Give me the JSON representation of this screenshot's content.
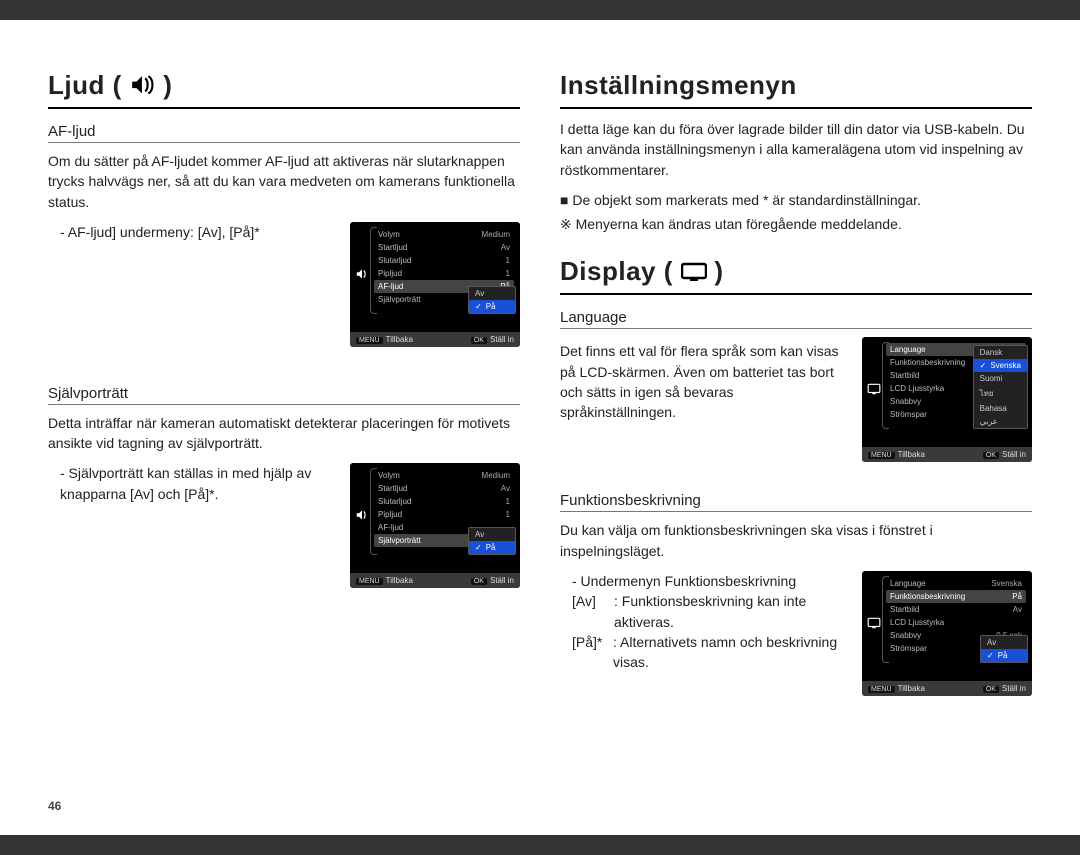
{
  "page_number": "46",
  "left": {
    "title_prefix": "Ljud (",
    "title_suffix": ")",
    "af": {
      "heading": "AF-ljud",
      "para": "Om du sätter på AF-ljudet kommer AF-ljud att aktiveras när slutarknappen trycks halvvägs ner, så att du kan vara medveten om kamerans funktionella status.",
      "submenu": "- AF-ljud] undermeny: [Av], [På]*"
    },
    "self": {
      "heading": "Självporträtt",
      "para": "Detta inträffar när kameran automatiskt detekterar placeringen för motivets ansikte vid tagning av självporträtt.",
      "submenu": "- Självporträtt kan ställas in med hjälp av knapparna [Av] och [På]*."
    },
    "lcd1": {
      "rows": [
        {
          "label": "Volym",
          "val": "Medium"
        },
        {
          "label": "Startljud",
          "val": "Av"
        },
        {
          "label": "Slutarljud",
          "val": "1"
        },
        {
          "label": "Pipljud",
          "val": "1"
        },
        {
          "label": "AF-ljud",
          "val": "På",
          "hl": true
        },
        {
          "label": "Självporträtt",
          "val": ""
        }
      ],
      "popup": [
        "Av",
        "På"
      ],
      "popup_sel": 1,
      "footer_left_key": "MENU",
      "footer_left": "Tillbaka",
      "footer_right_key": "OK",
      "footer_right": "Ställ in",
      "icon": "sound"
    },
    "lcd2": {
      "rows": [
        {
          "label": "Volym",
          "val": "Medium"
        },
        {
          "label": "Startljud",
          "val": "Av"
        },
        {
          "label": "Slutarljud",
          "val": "1"
        },
        {
          "label": "Pipljud",
          "val": "1"
        },
        {
          "label": "AF-ljud",
          "val": ""
        },
        {
          "label": "Självporträtt",
          "val": "På",
          "hl": true
        }
      ],
      "popup": [
        "Av",
        "På"
      ],
      "popup_sel": 1,
      "footer_left_key": "MENU",
      "footer_left": "Tillbaka",
      "footer_right_key": "OK",
      "footer_right": "Ställ in",
      "icon": "sound"
    }
  },
  "right": {
    "settings_title": "Inställningsmenyn",
    "settings_para": "I detta läge kan du föra över lagrade bilder till din dator via USB-kabeln. Du kan använda inställningsmenyn i alla kameralägena utom vid inspelning av röstkommentarer.",
    "settings_b1": "De objekt som markerats med * är standardinställningar.",
    "settings_b2": "Menyerna kan ändras utan föregående meddelande.",
    "display_title_prefix": "Display (",
    "display_title_suffix": ")",
    "lang": {
      "heading": "Language",
      "para": "Det finns ett val för flera språk som kan visas på LCD-skärmen. Även om batteriet tas bort och sätts in igen så bevaras språkinställningen."
    },
    "lcd_lang": {
      "rows": [
        {
          "label": "Language",
          "val": "Svenska",
          "hl": true
        },
        {
          "label": "Funktionsbeskrivning",
          "val": ""
        },
        {
          "label": "Startbild",
          "val": ""
        },
        {
          "label": "LCD Ljusstyrka",
          "val": ""
        },
        {
          "label": "Snabbvy",
          "val": ""
        },
        {
          "label": "Strömspar",
          "val": ""
        }
      ],
      "popup": [
        "Dansk",
        "Svenska",
        "Suomi",
        "ไทย",
        "Bahasa",
        "عربي"
      ],
      "popup_sel": 1,
      "footer_left_key": "MENU",
      "footer_left": "Tillbaka",
      "footer_right_key": "OK",
      "footer_right": "Ställ in",
      "icon": "display"
    },
    "func": {
      "heading": "Funktionsbeskrivning",
      "para": "Du kan välja om funktionsbeskrivningen ska visas i fönstret i inspelningsläget.",
      "sub_title": "- Undermenyn Funktionsbeskrivning",
      "opt_av_key": "[Av]",
      "opt_av_txt": ": Funktionsbeskrivning kan inte aktiveras.",
      "opt_pa_key": "[På]*",
      "opt_pa_txt": ": Alternativets namn och beskrivning visas."
    },
    "lcd_func": {
      "rows": [
        {
          "label": "Language",
          "val": "Svenska"
        },
        {
          "label": "Funktionsbeskrivning",
          "val": "På",
          "hl": true
        },
        {
          "label": "Startbild",
          "val": "Av"
        },
        {
          "label": "LCD Ljusstyrka",
          "val": ""
        },
        {
          "label": "Snabbvy",
          "val": "0.5 sek"
        },
        {
          "label": "Strömspar",
          "val": "Av"
        }
      ],
      "popup": [
        "Av",
        "På"
      ],
      "popup_sel": 1,
      "footer_left_key": "MENU",
      "footer_left": "Tillbaka",
      "footer_right_key": "OK",
      "footer_right": "Ställ in",
      "icon": "display"
    }
  }
}
